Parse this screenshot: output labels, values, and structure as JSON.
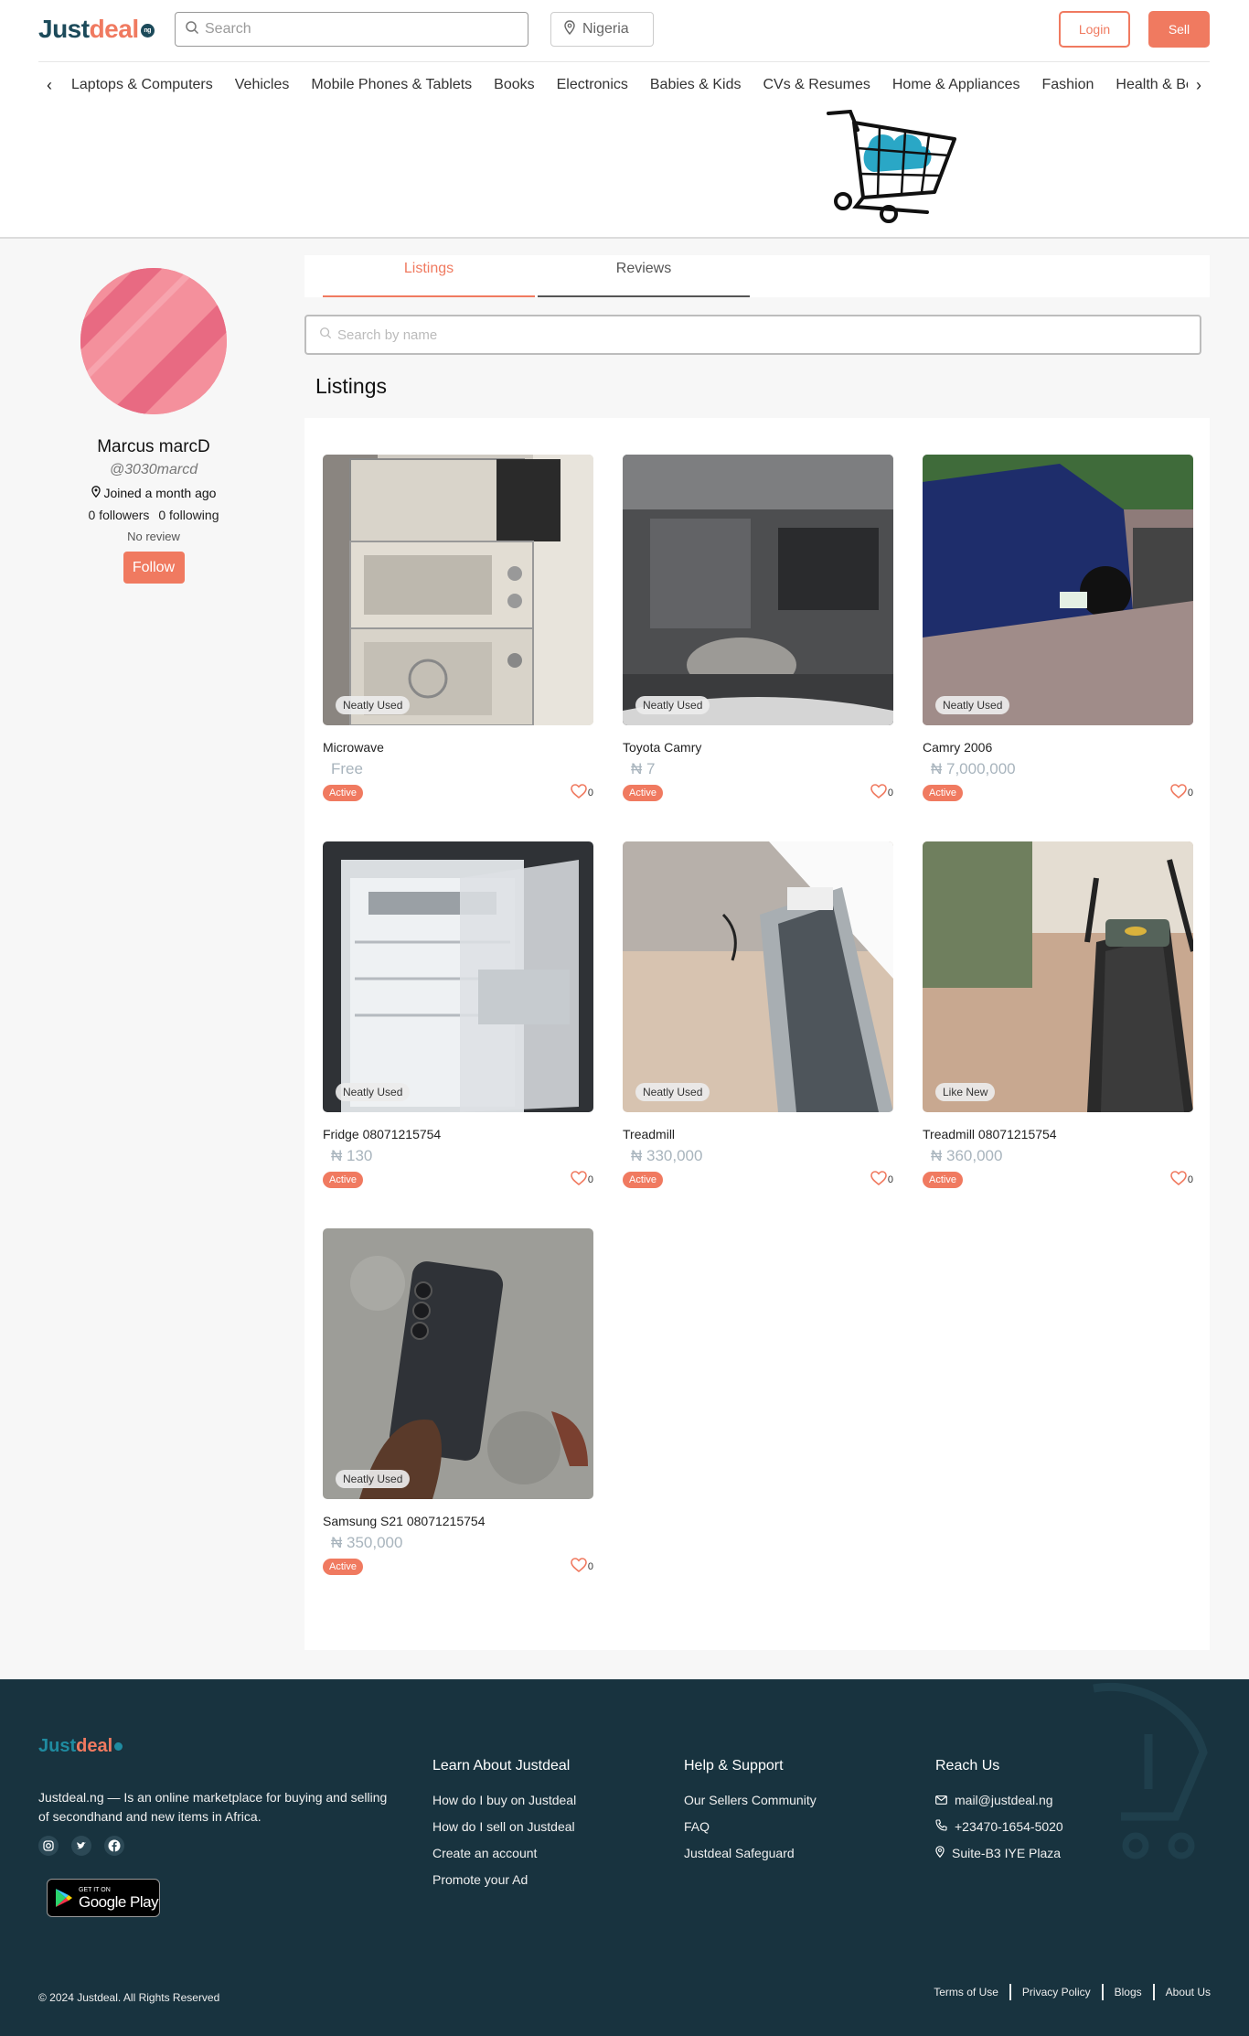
{
  "header": {
    "logo_main": "Justdeal",
    "logo_badge": "ng",
    "search_placeholder": "Search",
    "location": "Nigeria",
    "login_label": "Login",
    "sell_label": "Sell",
    "categories": [
      "Laptops & Computers",
      "Vehicles",
      "Mobile Phones & Tablets",
      "Books",
      "Electronics",
      "Babies & Kids",
      "CVs & Resumes",
      "Home & Appliances",
      "Fashion",
      "Health & Beauty"
    ]
  },
  "profile": {
    "name": "Marcus marcD",
    "handle": "@3030marcd",
    "joined": "Joined a month ago",
    "followers": "0 followers",
    "following": "0 following",
    "review": "No review",
    "follow_label": "Follow"
  },
  "tabs": {
    "listings": "Listings",
    "reviews": "Reviews"
  },
  "listings_search_placeholder": "Search by name",
  "listings_title": "Listings",
  "listings": [
    {
      "title": "Microwave",
      "price": "Free",
      "condition": "Neatly Used",
      "status": "Active",
      "likes": "0"
    },
    {
      "title": "Toyota Camry",
      "price": "₦ 7",
      "condition": "Neatly Used",
      "status": "Active",
      "likes": "0"
    },
    {
      "title": "Camry 2006",
      "price": "₦ 7,000,000",
      "condition": "Neatly Used",
      "status": "Active",
      "likes": "0"
    },
    {
      "title": "Fridge 08071215754",
      "price": "₦ 130",
      "condition": "Neatly Used",
      "status": "Active",
      "likes": "0"
    },
    {
      "title": "Treadmill",
      "price": "₦ 330,000",
      "condition": "Neatly Used",
      "status": "Active",
      "likes": "0"
    },
    {
      "title": "Treadmill 08071215754",
      "price": "₦ 360,000",
      "condition": "Like New",
      "status": "Active",
      "likes": "0"
    },
    {
      "title": "Samsung S21 08071215754",
      "price": "₦ 350,000",
      "condition": "Neatly Used",
      "status": "Active",
      "likes": "0"
    }
  ],
  "footer": {
    "logo": "Justdeal",
    "description": "Justdeal.ng — Is an online marketplace for buying and selling of secondhand and new items in Africa.",
    "gplay_small": "GET IT ON",
    "gplay_big": "Google Play",
    "learn_title": "Learn About Justdeal",
    "learn_links": [
      "How do I buy on Justdeal",
      "How do I sell on Justdeal",
      "Create an account",
      "Promote your Ad"
    ],
    "help_title": "Help & Support",
    "help_links": [
      "Our Sellers Community",
      "FAQ",
      "Justdeal Safeguard"
    ],
    "reach_title": "Reach Us",
    "email": "mail@justdeal.ng",
    "phone": "+23470-1654-5020",
    "address": "Suite-B3 IYE Plaza",
    "copyright": "© 2024 Justdeal. All Rights Reserved",
    "bottom_links": [
      "Terms of Use",
      "Privacy Policy",
      "Blogs",
      "About Us"
    ]
  },
  "colors": {
    "accent": "#f07a60",
    "brand_dark": "#1c4a5a",
    "footer_bg": "#18333f"
  }
}
